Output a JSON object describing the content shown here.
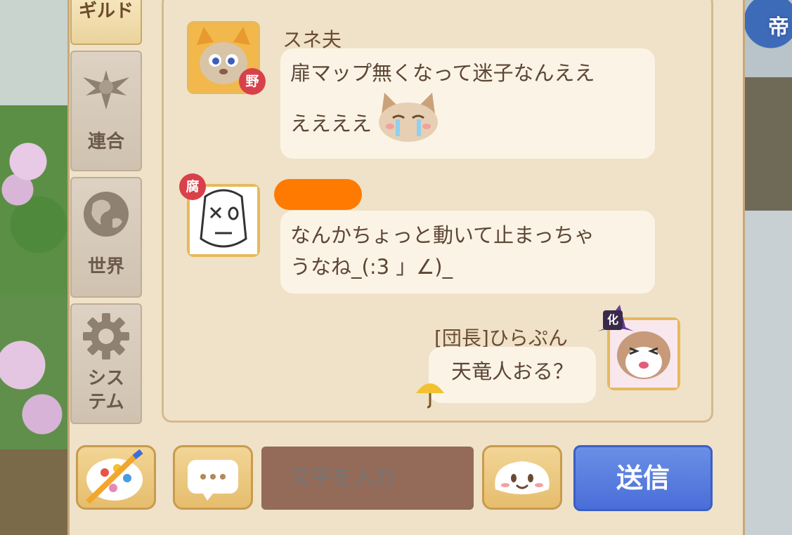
{
  "background": {
    "corner_text": "帝"
  },
  "sidebar": {
    "tabs": [
      {
        "label": "ギルド",
        "icon": "guild-tab",
        "active": true
      },
      {
        "label": "連合",
        "icon": "alliance-emblem-icon",
        "active": false
      },
      {
        "label": "世界",
        "icon": "globe-icon",
        "active": false
      },
      {
        "label": "システム",
        "icon": "gear-icon",
        "active": false
      }
    ]
  },
  "chat": {
    "messages": [
      {
        "sender": "スネ夫",
        "badge": "野",
        "lines": [
          "扉マップ無くなって迷子なんええ",
          "ええええ"
        ],
        "side": "left"
      },
      {
        "sender": "",
        "badge": "腐",
        "lines": [
          "なんかちょっと動いて止まっちゃ",
          "うなね_(:3 」∠)_"
        ],
        "side": "left"
      },
      {
        "sender": "[団長]ひらぷん",
        "badge": "化",
        "lines": [
          "天竜人おる？"
        ],
        "side": "right"
      }
    ]
  },
  "input": {
    "placeholder": "文字を入力"
  },
  "buttons": {
    "send_label": "送信"
  },
  "colors": {
    "panel": "#efe2c8",
    "bubble": "#fbf4e6",
    "text": "#5d4535",
    "send": "#5a7ee0",
    "input": "#946a58"
  }
}
